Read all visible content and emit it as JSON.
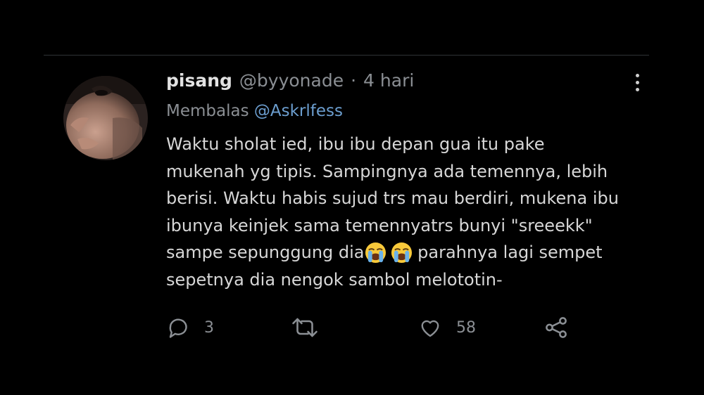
{
  "tweet": {
    "author_name": "pisang",
    "author_handle": "@byyonade",
    "separator": "·",
    "timestamp": "4 hari",
    "reply_prefix": "Membalas",
    "reply_to": "@Askrlfess",
    "lines": [
      "Waktu sholat ied, ibu ibu depan gua itu pake",
      "mukenah yg tipis. Sampingnya ada temennya, lebih",
      "berisi. Waktu habis sujud trs mau berdiri, mukena ibu",
      "ibunya keinjek sama temennyatrs bunyi \"sreeekk\"",
      "sampe sepunggung dia",
      " parahnya lagi sempet",
      "sepetnya dia nengok sambol melototin-"
    ],
    "emoji": [
      "loudly-crying-face-emoji",
      "loudly-crying-face-emoji"
    ]
  },
  "actions": {
    "reply_count": "3",
    "retweet_count": "",
    "like_count": "58",
    "icons": [
      "reply-icon",
      "retweet-icon",
      "like-icon",
      "share-icon"
    ]
  },
  "colors": {
    "background": "#000000",
    "text": "#d7d7d7",
    "secondary": "#8b8f94",
    "link": "#6c9ecf",
    "divider": "#2f3336"
  }
}
